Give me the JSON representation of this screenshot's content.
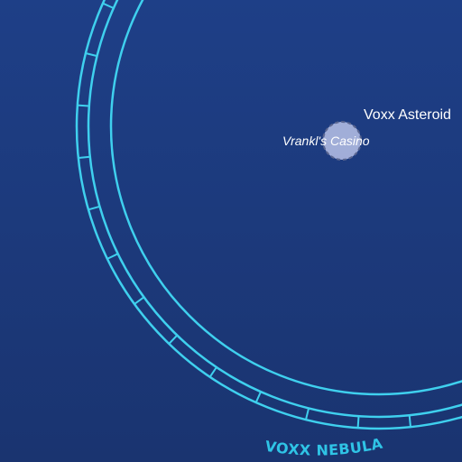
{
  "map": {
    "region_label": "VOXX NEBULA",
    "body_label": "Voxx Asteroid",
    "place_label": "Vrankl's Casino",
    "colors": {
      "background_top": "#1e3f87",
      "background_bottom": "#1a3470",
      "orbit_ring": "#3fd0ee",
      "region_text": "#2fc4e6",
      "marker_fill": "#b9c2e8",
      "marker_stroke": "#5a6690",
      "text": "#ffffff"
    }
  }
}
